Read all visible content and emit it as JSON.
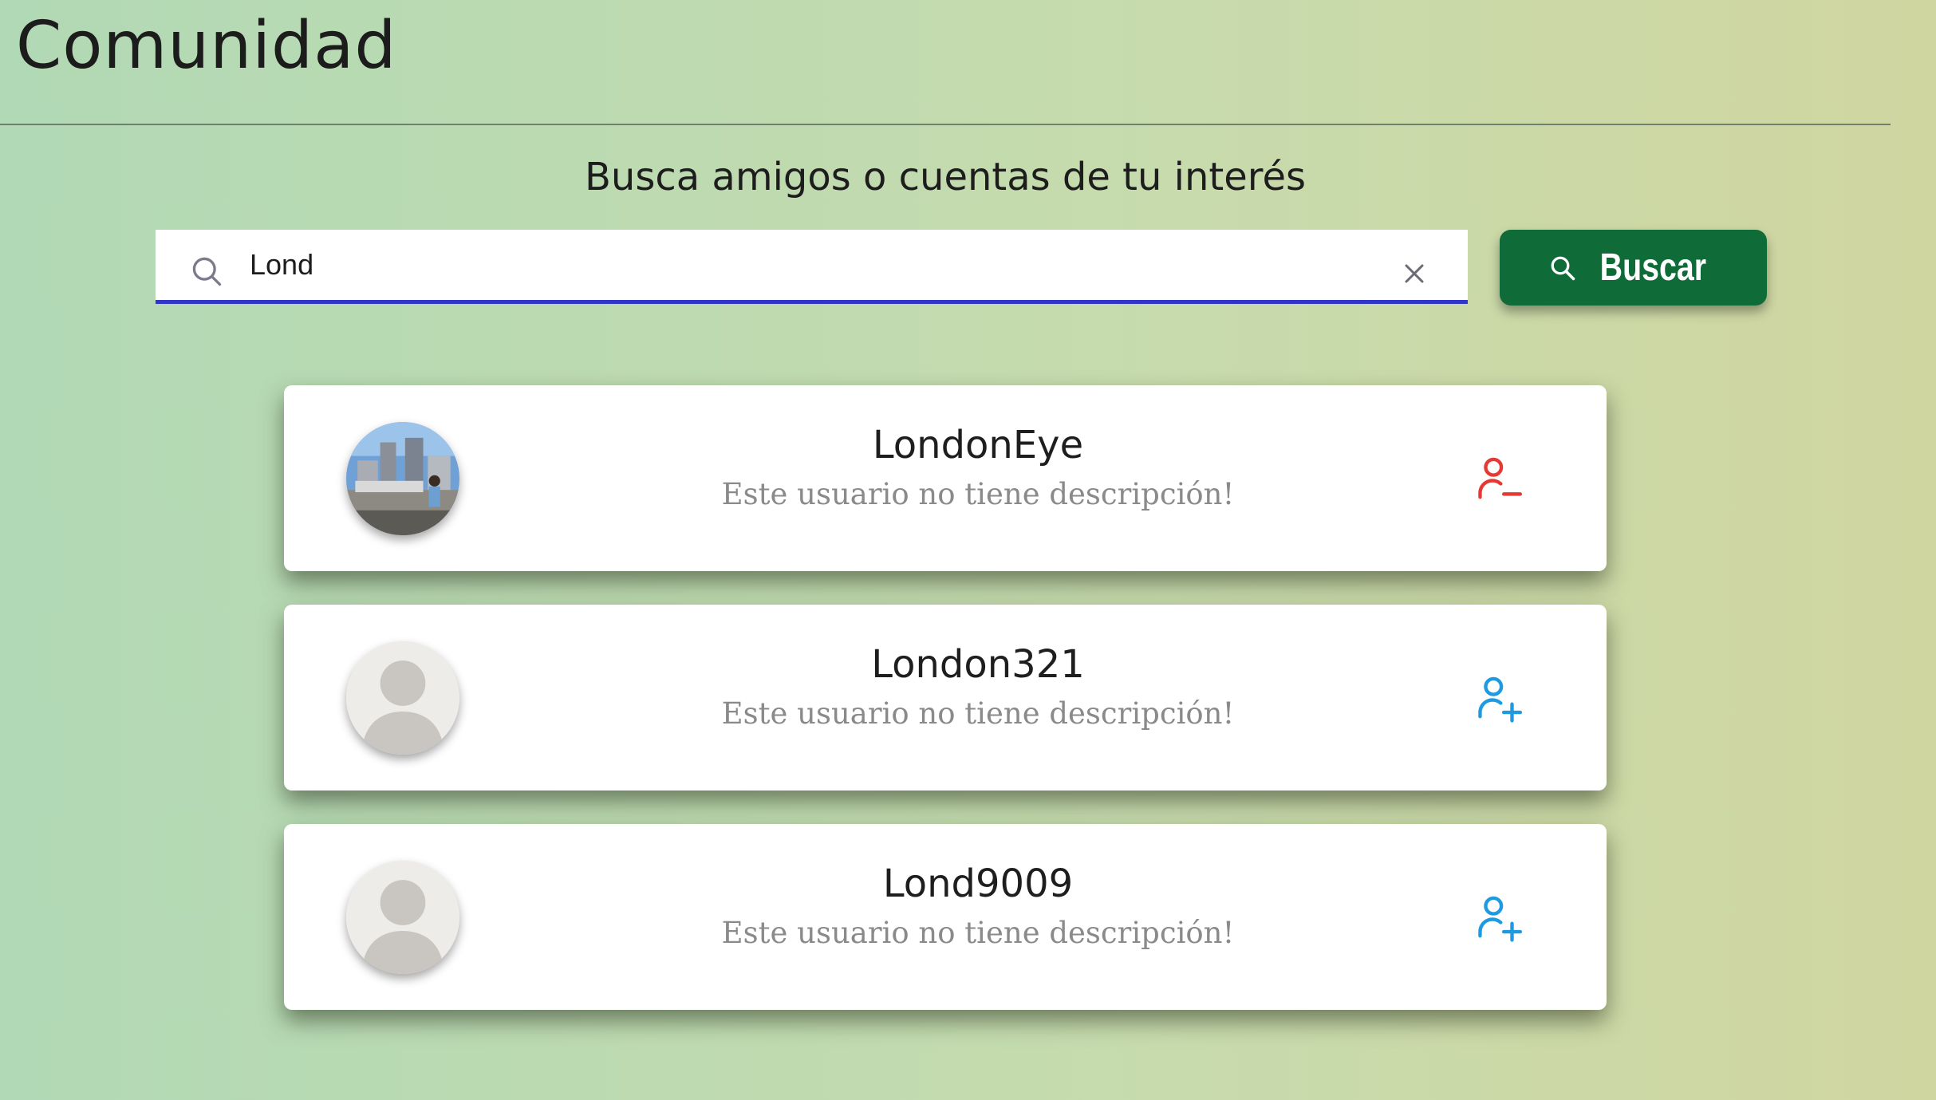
{
  "page": {
    "title": "Comunidad",
    "subtitle": "Busca amigos o cuentas de tu interés"
  },
  "search": {
    "value": "Lond",
    "button_label": "Buscar",
    "button_color": "#0f6b38",
    "underline_color": "#3236c8"
  },
  "results": [
    {
      "username": "LondonEye",
      "description": "Este usuario no tiene descripción!",
      "avatar": "photo",
      "action": "remove-friend-icon",
      "action_color": "#e53935"
    },
    {
      "username": "London321",
      "description": "Este usuario no tiene descripción!",
      "avatar": "default-user-avatar",
      "action": "add-friend-icon",
      "action_color": "#1e9be0"
    },
    {
      "username": "Lond9009",
      "description": "Este usuario no tiene descripción!",
      "avatar": "default-user-avatar",
      "action": "add-friend-icon",
      "action_color": "#1e9be0"
    }
  ]
}
